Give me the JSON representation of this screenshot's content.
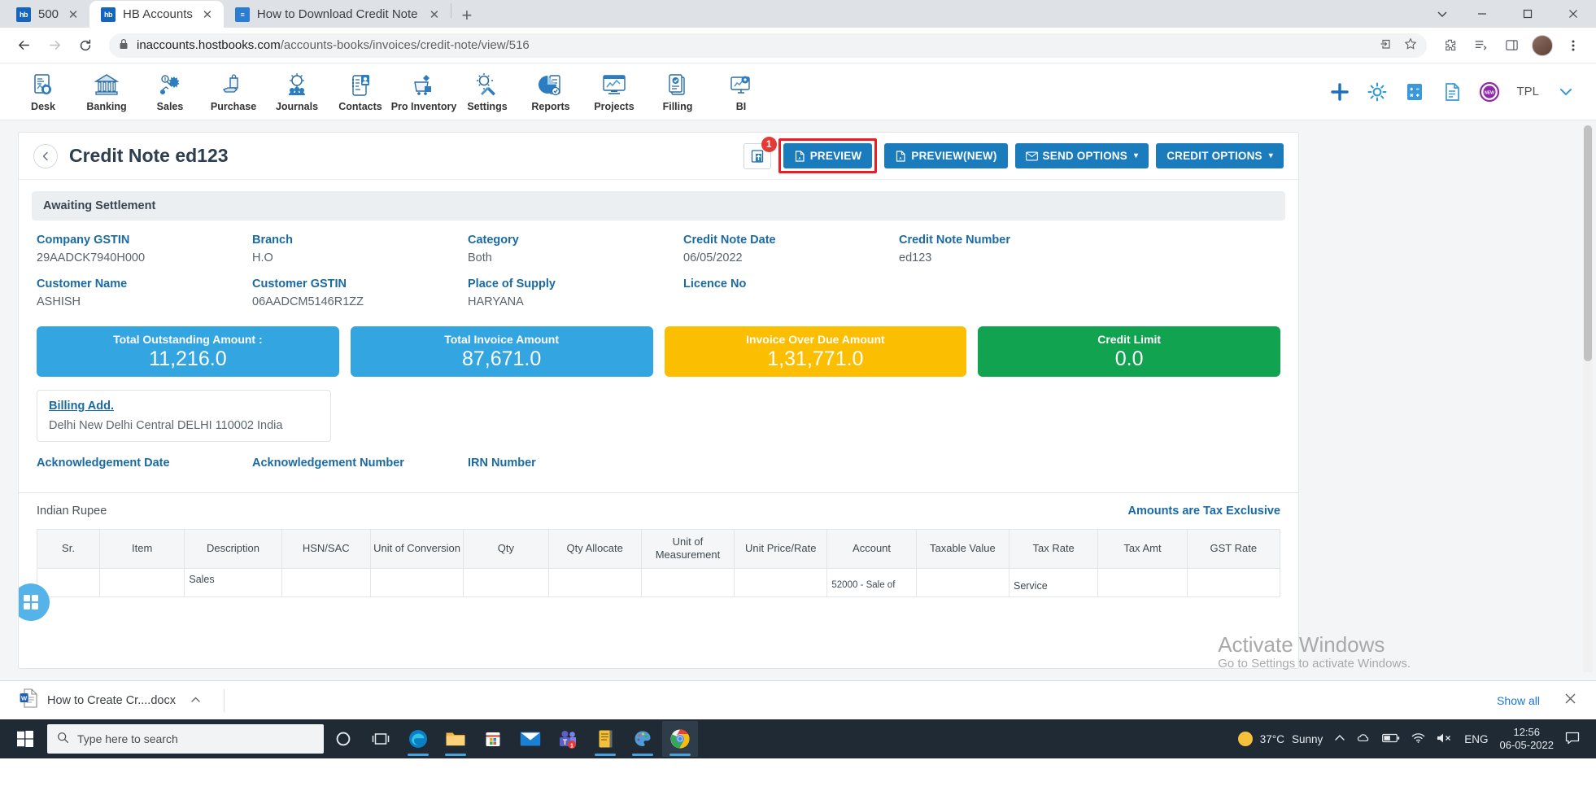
{
  "browser": {
    "tabs": [
      {
        "title": "500",
        "favicon": "hb-icon",
        "active": false
      },
      {
        "title": "HB Accounts",
        "favicon": "hb-icon",
        "active": true
      },
      {
        "title": "How to Download Credit Note a",
        "favicon": "doc-icon",
        "active": false
      }
    ],
    "new_tab_label": "+",
    "close_label": "✕",
    "window_controls": {
      "minimize": "—",
      "maximize": "▢",
      "close": "✕",
      "chevron": "⌄"
    },
    "nav": {
      "back": "←",
      "forward": "→",
      "reload": "⟳"
    },
    "url": {
      "lock": "🔒",
      "host": "inaccounts.hostbooks.com",
      "path": "/accounts-books/invoices/credit-note/view/516",
      "share_icon": "share-icon",
      "bookmark_icon": "star-icon"
    },
    "toolbar_icons": [
      "extensions-icon",
      "reading-list-icon",
      "sidepanel-icon",
      "profile-avatar",
      "menu-icon"
    ]
  },
  "appnav": {
    "items": [
      {
        "label": "Desk",
        "icon": "desk-icon"
      },
      {
        "label": "Banking",
        "icon": "bank-icon"
      },
      {
        "label": "Sales",
        "icon": "sales-icon"
      },
      {
        "label": "Purchase",
        "icon": "purchase-icon"
      },
      {
        "label": "Journals",
        "icon": "journals-icon"
      },
      {
        "label": "Contacts",
        "icon": "contacts-icon"
      },
      {
        "label": "Pro Inventory",
        "icon": "inventory-icon"
      },
      {
        "label": "Settings",
        "icon": "settings-icon"
      },
      {
        "label": "Reports",
        "icon": "reports-icon"
      },
      {
        "label": "Projects",
        "icon": "projects-icon"
      },
      {
        "label": "Filling",
        "icon": "filling-icon"
      },
      {
        "label": "BI",
        "icon": "bi-icon"
      }
    ],
    "right_icons": [
      "plus-icon",
      "gear-icon",
      "calculator-icon",
      "document-icon",
      "new-badge-icon"
    ],
    "tpl_label": "TPL",
    "dropdown_caret": "⌄"
  },
  "page": {
    "back_icon": "chevron-left-icon",
    "title": "Credit Note ed123",
    "export_badge": "1",
    "buttons": [
      {
        "label": "PREVIEW",
        "icon": "pdf-icon",
        "highlighted": true,
        "caret": false
      },
      {
        "label": "PREVIEW(NEW)",
        "icon": "pdf-icon",
        "highlighted": false,
        "caret": false
      },
      {
        "label": "SEND OPTIONS",
        "icon": "envelope-icon",
        "highlighted": false,
        "caret": true
      },
      {
        "label": "CREDIT OPTIONS",
        "icon": "",
        "highlighted": false,
        "caret": true
      }
    ],
    "status": "Awaiting Settlement",
    "fields_row1": [
      {
        "label": "Company GSTIN",
        "value": "29AADCK7940H000"
      },
      {
        "label": "Branch",
        "value": "H.O"
      },
      {
        "label": "Category",
        "value": "Both"
      },
      {
        "label": "Credit Note Date",
        "value": "06/05/2022"
      },
      {
        "label": "Credit Note Number",
        "value": "ed123"
      }
    ],
    "fields_row2": [
      {
        "label": "Customer Name",
        "value": "ASHISH"
      },
      {
        "label": "Customer GSTIN",
        "value": "06AADCM5146R1ZZ"
      },
      {
        "label": "Place of Supply",
        "value": "HARYANA"
      },
      {
        "label": "Licence No",
        "value": ""
      }
    ],
    "summary_cards": [
      {
        "label": "Total Outstanding Amount :",
        "value": "11,216.0",
        "color": "#33a5e0"
      },
      {
        "label": "Total Invoice Amount",
        "value": "87,671.0",
        "color": "#33a5e0"
      },
      {
        "label": "Invoice Over Due Amount",
        "value": "1,31,771.0",
        "color": "#fcbe00"
      },
      {
        "label": "Credit Limit",
        "value": "0.0",
        "color": "#12a350"
      }
    ],
    "billing": {
      "title": "Billing Add.",
      "address": "Delhi New Delhi Central DELHI 110002 India"
    },
    "ack_fields": [
      {
        "label": "Acknowledgement Date"
      },
      {
        "label": "Acknowledgement Number"
      },
      {
        "label": "IRN Number"
      }
    ],
    "currency": "Indian Rupee",
    "tax_note": "Amounts are Tax Exclusive",
    "table": {
      "columns": [
        "Sr.",
        "Item",
        "Description",
        "HSN/SAC",
        "Unit of Conversion",
        "Qty",
        "Qty Allocate",
        "Unit of Measurement",
        "Unit Price/Rate",
        "Account",
        "Taxable Value",
        "Tax Rate",
        "Tax Amt",
        "GST Rate"
      ],
      "rows": [
        {
          "sr": "",
          "item": "",
          "description": "Sales",
          "hsn": "",
          "unit_of_conversion": "",
          "qty": "",
          "qty_allocate": "",
          "unit_of_measurement": "",
          "unit_price": "",
          "account": "52000 - Sale of",
          "taxable_value": "",
          "tax_rate": "Service",
          "tax_amt": "",
          "gst_rate": ""
        }
      ]
    },
    "fab_icon": "grid-widget-icon"
  },
  "watermark": {
    "line1": "Activate Windows",
    "line2": "Go to Settings to activate Windows."
  },
  "download_bar": {
    "file_name": "How to Create Cr....docx",
    "file_icon": "word-doc-icon",
    "caret": "⌃",
    "show_all": "Show all",
    "close": "✕"
  },
  "taskbar": {
    "start_icon": "windows-start-icon",
    "search_placeholder": "Type here to search",
    "search_icon": "search-icon",
    "icons": [
      "cortana-icon",
      "task-view-icon",
      "edge-icon",
      "file-explorer-icon",
      "store-icon",
      "mail-icon",
      "teams-icon",
      "notes-icon",
      "paint-icon",
      "chrome-icon"
    ],
    "weather": {
      "temp": "37°C",
      "condition": "Sunny"
    },
    "tray_icons": [
      "chevron-up-icon",
      "onedrive-icon",
      "battery-icon",
      "wifi-icon",
      "volume-mute-icon"
    ],
    "language": "ENG",
    "time": "12:56",
    "date": "06-05-2022",
    "notification_icon": "notification-icon"
  }
}
